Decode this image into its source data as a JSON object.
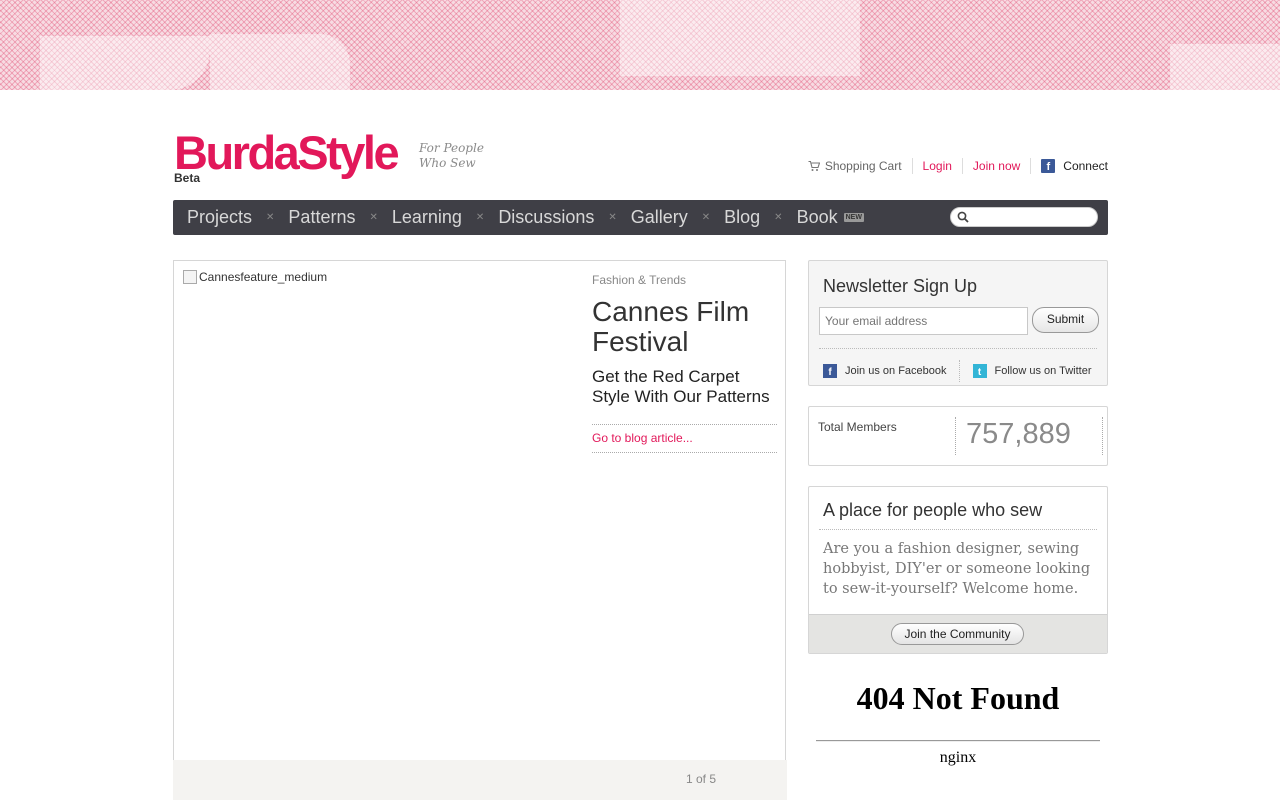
{
  "header": {
    "logo_text": "BurdaStyle",
    "logo_beta": "Beta",
    "tagline_line1": "For People",
    "tagline_line2": "Who Sew"
  },
  "user_nav": {
    "cart_label": "Shopping Cart",
    "cart_icon": "shopping-cart-icon",
    "login_label": "Login",
    "join_label": "Join now",
    "connect_label": "Connect",
    "connect_icon": "facebook-icon"
  },
  "main_nav": {
    "items": [
      {
        "label": "Projects"
      },
      {
        "label": "Patterns"
      },
      {
        "label": "Learning"
      },
      {
        "label": "Discussions"
      },
      {
        "label": "Gallery"
      },
      {
        "label": "Blog"
      },
      {
        "label": "Book",
        "badge": "NEW"
      }
    ],
    "search_placeholder": "",
    "search_icon": "search-icon"
  },
  "feature": {
    "image_alt": "Cannesfeature_medium",
    "category": "Fashion & Trends",
    "title": "Cannes Film Festival",
    "subtitle": "Get the Red Carpet Style With Our Patterns",
    "link_label": "Go to blog article...",
    "pager": "1 of 5"
  },
  "newsletter": {
    "title": "Newsletter Sign Up",
    "email_placeholder": "Your email address",
    "submit_label": "Submit",
    "facebook_label": "Join us on Facebook",
    "twitter_label": "Follow us on Twitter"
  },
  "members": {
    "label": "Total Members",
    "count": "757,889"
  },
  "about": {
    "title": "A place for people who sew",
    "body": "Are you a fashion designer, sewing hobbyist, DIY'er or someone looking to sew-it-yourself? Welcome home.",
    "join_label": "Join the Community"
  },
  "error_frame": {
    "title": "404 Not Found",
    "server": "nginx"
  },
  "colors": {
    "brand_pink": "#e2185a",
    "nav_background": "#3f3f46",
    "facebook_blue": "#3b5998",
    "twitter_blue": "#33b5d6"
  }
}
